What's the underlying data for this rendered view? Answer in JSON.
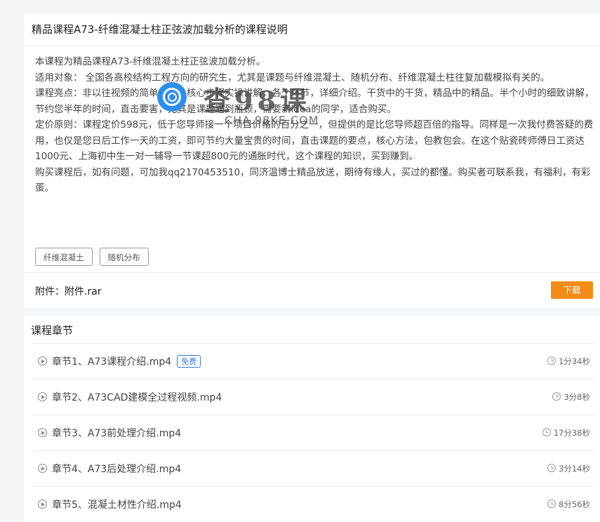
{
  "course": {
    "title": "精品课程A73-纤维混凝土柱正弦波加载分析的课程说明",
    "description": [
      "本课程为精品课程A73-纤维混凝土柱正弦波加载分析。",
      "适用对象： 全国各高校结构工程方向的研究生，尤其是课题与纤维混凝土、随机分布、纤维混凝土柱往复加载模拟有关的。",
      "课程亮点：非以往视频的简单介绍，核心步骤实操讲解，各个环节，详细介绍。干货中的干货，精品中的精品。半个小时的细致讲解，节约您半年的时间，直击要害，尤其是课题遇到瓶颈，需要新idea的同学，适合购买。",
      "定价原则：课程定价598元，低于您导师接一个项目价格的百分之一，但提供的是比您导师超百倍的指导。同样是一次我付费答疑的费用，也仅是您日后工作一天的工资，即可节约大量宝贵的时间，直击课题的要点，核心方法，包教包会。在这个贴瓷砖师傅日工资达1000元、上海初中生一对一辅导一节课超800元的通胀时代，这个课程的知识，买到赚到。",
      "购买课程后，如有问题，可加我qq2170453510，同济温博士精品放送，期待有缘人，买过的都懂。购买者可联系我，有福利，有彩蛋。"
    ],
    "tags": [
      "纤维混凝土",
      "随机分布"
    ],
    "attachment_label": "附件：附件.rar",
    "download_label": "下载"
  },
  "watermark": {
    "text": "查98课",
    "domain": "CHA.98KE.COM"
  },
  "chapters": {
    "title": "课程章节",
    "items": [
      {
        "title": "章节1、A73课程介绍.mp4",
        "badge": "免费",
        "duration": "1分34秒"
      },
      {
        "title": "章节2、A73CAD建模全过程视频.mp4",
        "badge": "",
        "duration": "3分8秒"
      },
      {
        "title": "章节3、A73前处理介绍.mp4",
        "badge": "",
        "duration": "17分38秒"
      },
      {
        "title": "章节4、A73后处理介绍.mp4",
        "badge": "",
        "duration": "3分14秒"
      },
      {
        "title": "章节5、混凝土材性介绍.mp4",
        "badge": "",
        "duration": "8分56秒"
      }
    ]
  },
  "colors": {
    "accent_orange": "#f08c17",
    "free_badge_blue": "#2f7fd0"
  },
  "icons": {
    "chapter": "play-circle-icon",
    "duration": "clock-icon",
    "watermark_logo": "watermark-logo-icon"
  }
}
